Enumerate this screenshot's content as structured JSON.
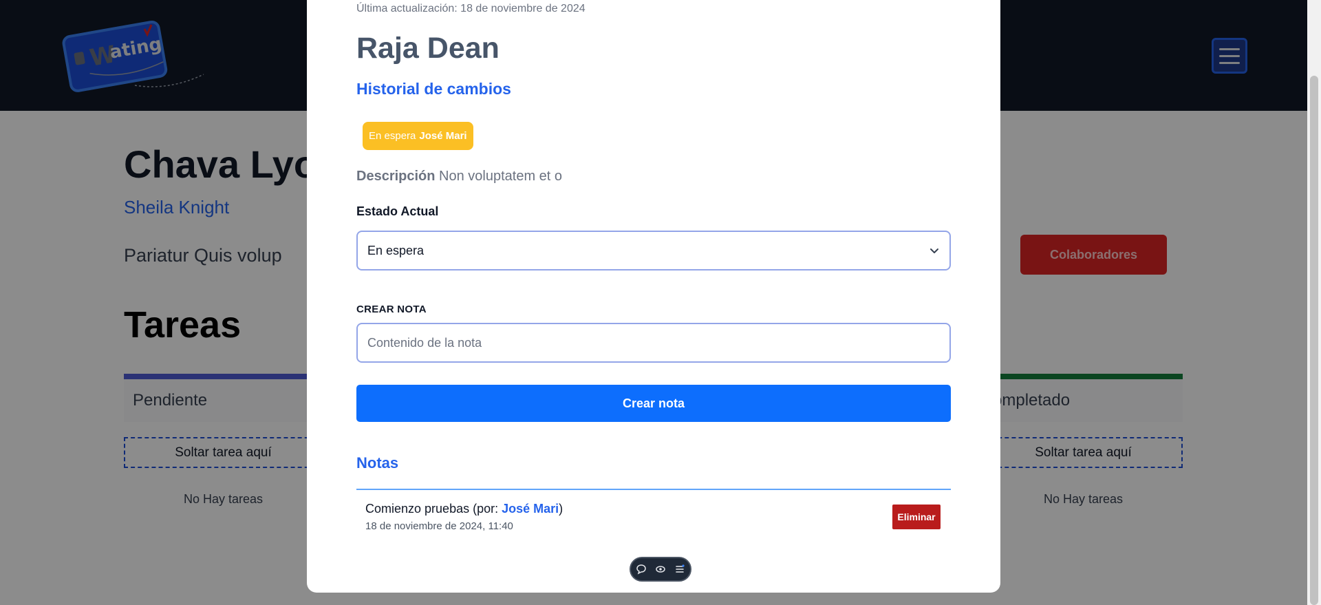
{
  "header": {
    "logo_text": "Wating",
    "menu_icon": "hamburger-icon"
  },
  "project": {
    "title": "Chava Lyo",
    "client": "Sheila Knight",
    "description": "Pariatur Quis volup",
    "collaborators_label": "Colaboradores",
    "tasks_heading": "Tareas"
  },
  "columns": [
    {
      "title": "Pendiente",
      "drop_label": "Soltar tarea aquí",
      "empty_label": "No Hay tareas",
      "color": "#4f5bd5"
    },
    {
      "title": "ompletado",
      "drop_label": "Soltar tarea aquí",
      "empty_label": "No Hay tareas",
      "color": "#15803d"
    }
  ],
  "modal": {
    "updated": "Última actualización: 18 de noviembre de 2024",
    "title": "Raja Dean",
    "history_label": "Historial de cambios",
    "history_badge": {
      "status": "En espera",
      "user": "José Mari",
      "color": "#fbbf24"
    },
    "description_label": "Descripción",
    "description_value": "Non voluptatem et o",
    "state_label": "Estado Actual",
    "state_value": "En espera",
    "note_label": "CREAR NOTA",
    "note_placeholder": "Contenido de la nota",
    "create_button": "Crear nota",
    "notes_heading": "Notas",
    "notes": [
      {
        "text": "Comienzo pruebas",
        "by_prefix": " (por: ",
        "author": "José Mari",
        "by_suffix": ")",
        "date": "18 de noviembre de 2024, 11:40",
        "delete_label": "Eliminar"
      }
    ]
  },
  "accent_colors": {
    "primary": "#0d6efd",
    "danger": "#b91c1c",
    "warning": "#fbbf24",
    "header": "#111827"
  }
}
